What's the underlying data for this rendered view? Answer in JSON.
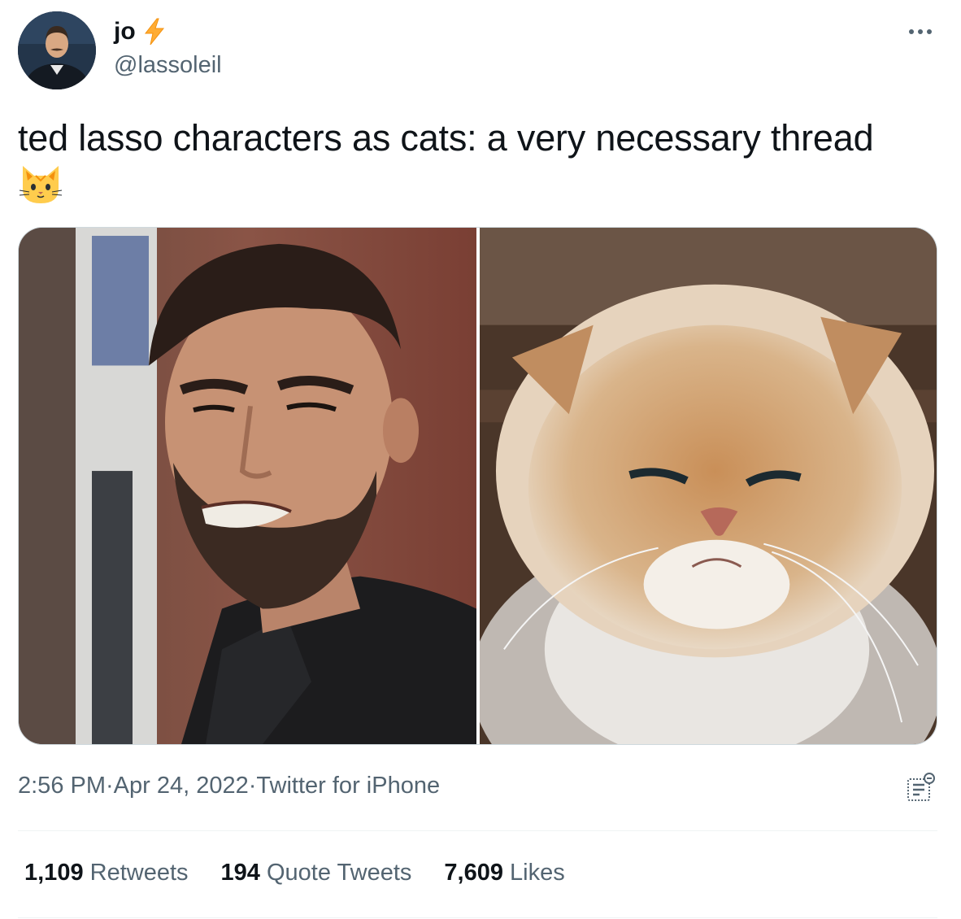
{
  "user": {
    "display_name": "jo",
    "name_emoji_icon": "lightning-bolt-icon",
    "handle": "@lassoleil",
    "avatar_alt": "profile avatar"
  },
  "tweet": {
    "text": "ted lasso characters as cats: a very necessary thread",
    "trailing_emoji_icon": "cat-face-emoji"
  },
  "media": [
    {
      "description_icon": "man-grimacing-photo"
    },
    {
      "description_icon": "grumpy-fluffy-cat-photo"
    }
  ],
  "meta": {
    "time": "2:56 PM",
    "separator": " · ",
    "date": "Apr 24, 2022",
    "source": "Twitter for iPhone"
  },
  "stats": {
    "retweets_count": "1,109",
    "retweets_label": "Retweets",
    "quotes_count": "194",
    "quotes_label": "Quote Tweets",
    "likes_count": "7,609",
    "likes_label": "Likes"
  },
  "colors": {
    "text_primary": "#0f1419",
    "text_secondary": "#536471",
    "bolt": "#ffac33",
    "divider": "#eff3f4"
  }
}
